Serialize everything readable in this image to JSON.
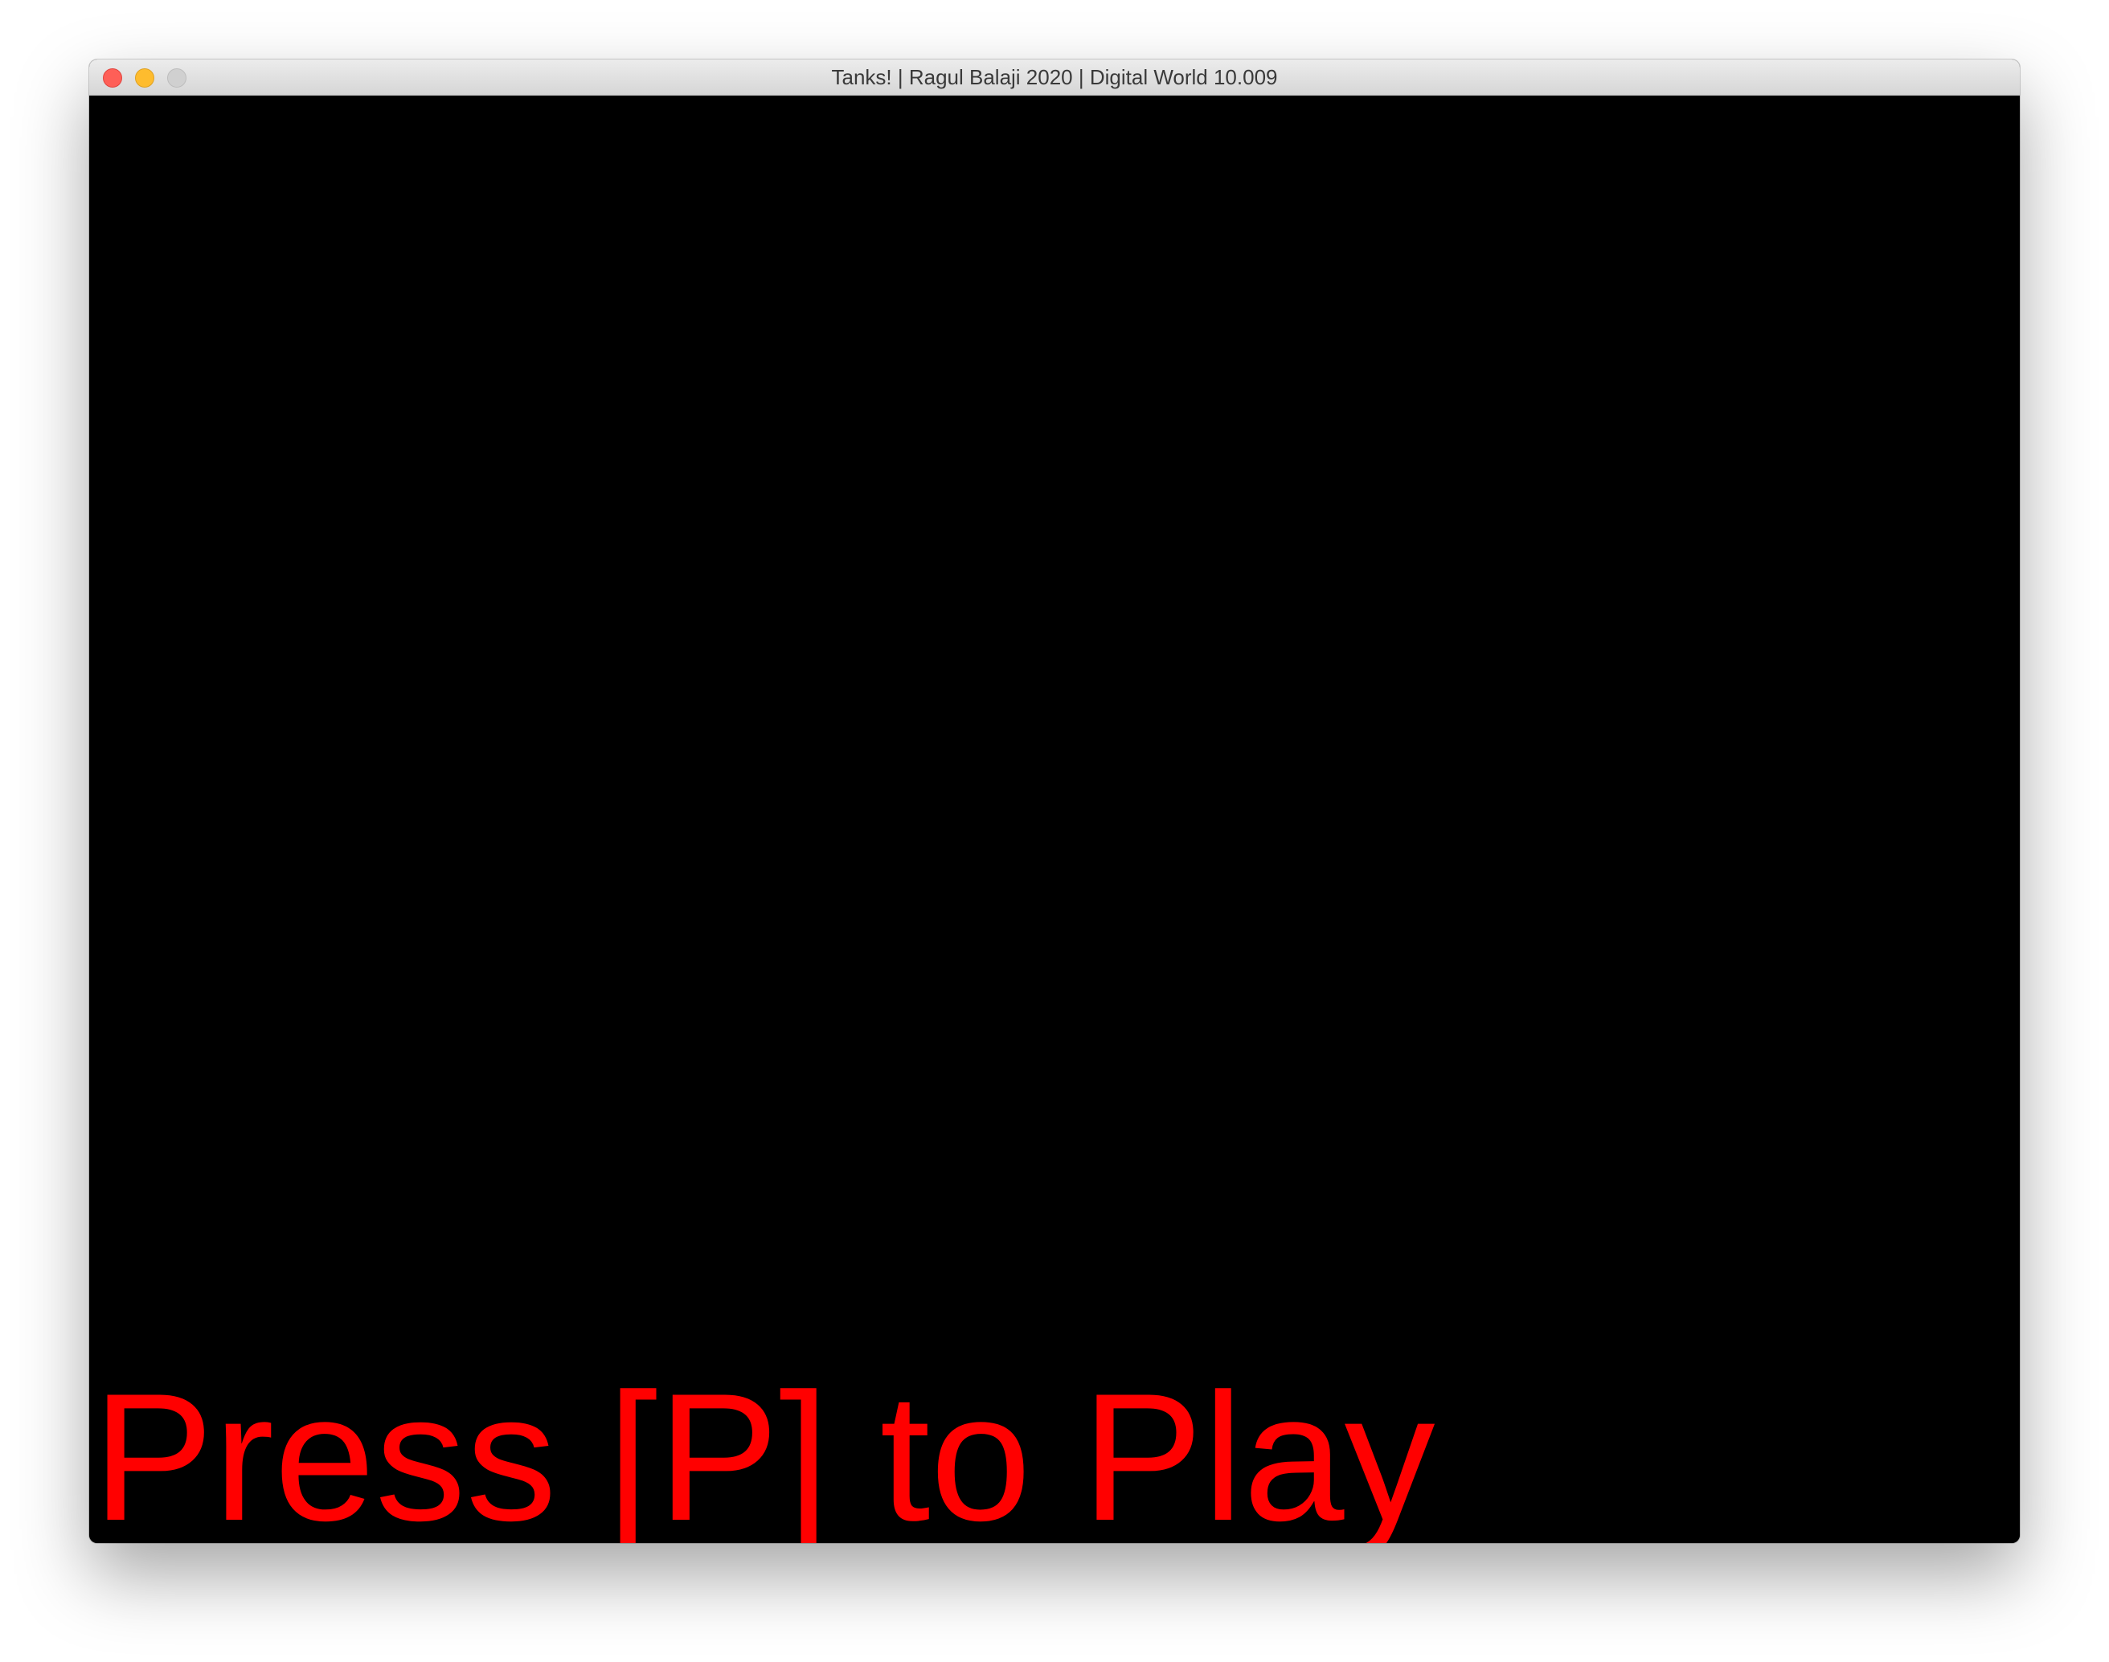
{
  "window": {
    "title": "Tanks! | Ragul Balaji 2020 | Digital World 10.009",
    "controls": {
      "close_color": "#fe5f57",
      "minimize_color": "#febc2e",
      "zoom_color": "#d0d0d0"
    }
  },
  "game": {
    "background_color": "#000000",
    "prompt_text": "Press [P] to Play",
    "prompt_color": "#ff0000"
  }
}
